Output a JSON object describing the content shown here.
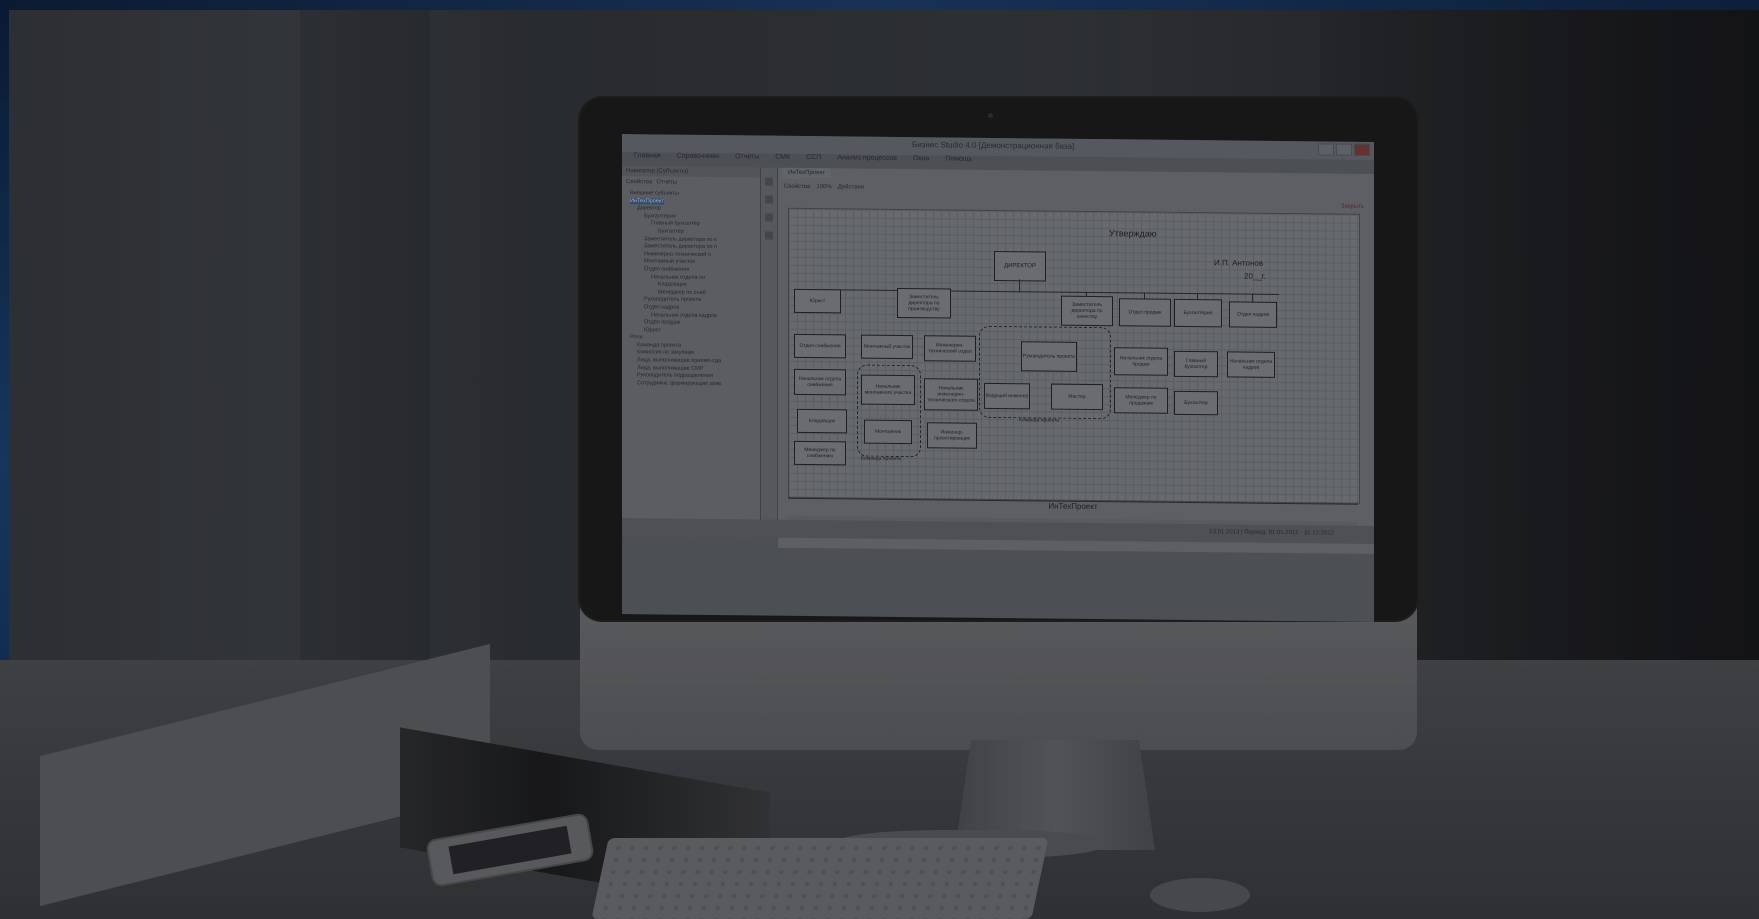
{
  "window": {
    "title": "Бизнес Studio 4.0 [Демонстрационная база]"
  },
  "menu": [
    "Главная",
    "Справочники",
    "Отчеты",
    "СМК",
    "ССП",
    "Анализ процессов",
    "Окна",
    "Помощь"
  ],
  "navigator": {
    "header": "Навигатор (Субъекты)",
    "toolbar_properties": "Свойства",
    "toolbar_reports": "Отчеты",
    "tree": [
      "Внешние субъекты",
      "ИнТехПроект",
      "Директор",
      "Бухгалтерия",
      "Главный бухгалтер",
      "Бухгалтер",
      "Заместитель директора по к",
      "Заместитель директора по п",
      "Инженерно-технический о",
      "Монтажный участок",
      "Отдел снабжения",
      "Начальник отдела сн",
      "Кладовщик",
      "Менеджер по снаб",
      "Руководитель проекта",
      "Отдел кадров",
      "Начальник отдела кадров",
      "Отдел продаж",
      "Юрист",
      "Роли",
      "Команда проекта",
      "Комиссия по закупкам",
      "Лица, выполняющие приемо-сда",
      "Лица, выполняющие СМР",
      "Руководитель подразделения",
      "Сотрудники, формирующие заяв"
    ],
    "selected_index": 1
  },
  "document": {
    "tab": "ИнТехПроект",
    "toolbar_properties": "Свойства",
    "zoom": "100%",
    "actions": "Действия",
    "close": "Закрыть",
    "approve_title": "Утверждаю",
    "approve_name": "И.П. Антонов",
    "approve_date": "20__г.",
    "footer_label": "ИнТехПроект",
    "status": "13.01.2013 | Период: 01.01.2012 - 31.12.2012"
  },
  "org_chart": {
    "director": "ДИРЕКТОР",
    "nodes": [
      "Юрист",
      "Заместитель директора по производству",
      "Заместитель директора по качеству",
      "Отдел продаж",
      "Бухгалтерия",
      "Отдел кадров",
      "Отдел снабжения",
      "Монтажный участок",
      "Инженерно-технический отдел",
      "Руководитель проекта",
      "Начальник отдела продаж",
      "Главный бухгалтер",
      "Начальник отдела кадров",
      "Начальник отдела снабжения",
      "Начальник монтажного участка",
      "Начальник инженерно-технического отдела",
      "Ведущий инженер",
      "Мастер",
      "Менеджер по продажам",
      "Бухгалтер",
      "Кладовщик",
      "Монтажник",
      "Инженер-проектировщик",
      "Менеджер по снабжению"
    ],
    "group_labels": [
      "Команда проекта",
      "Команда проекта"
    ]
  }
}
